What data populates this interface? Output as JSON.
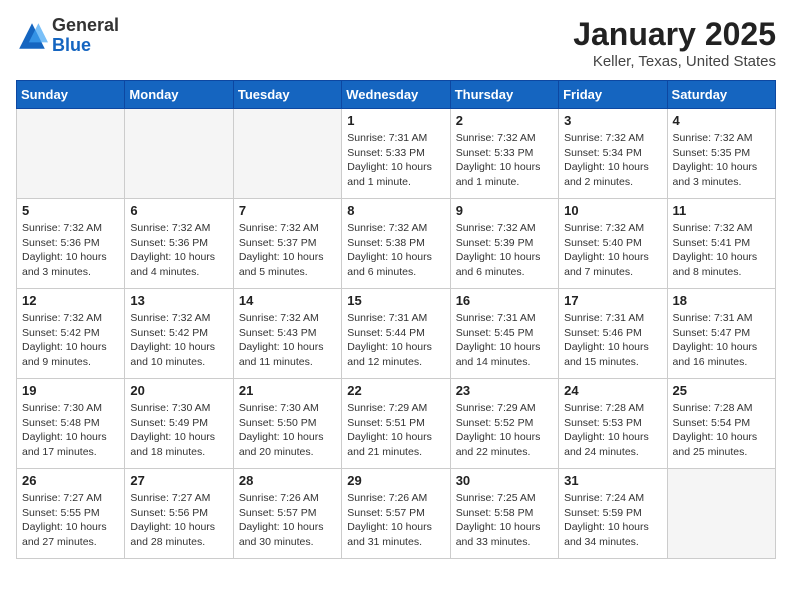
{
  "header": {
    "logo": {
      "general": "General",
      "blue": "Blue"
    },
    "title": "January 2025",
    "subtitle": "Keller, Texas, United States"
  },
  "weekdays": [
    "Sunday",
    "Monday",
    "Tuesday",
    "Wednesday",
    "Thursday",
    "Friday",
    "Saturday"
  ],
  "weeks": [
    [
      {
        "day": "",
        "empty": true
      },
      {
        "day": "",
        "empty": true
      },
      {
        "day": "",
        "empty": true
      },
      {
        "day": "1",
        "sunrise": "Sunrise: 7:31 AM",
        "sunset": "Sunset: 5:33 PM",
        "daylight": "Daylight: 10 hours and 1 minute."
      },
      {
        "day": "2",
        "sunrise": "Sunrise: 7:32 AM",
        "sunset": "Sunset: 5:33 PM",
        "daylight": "Daylight: 10 hours and 1 minute."
      },
      {
        "day": "3",
        "sunrise": "Sunrise: 7:32 AM",
        "sunset": "Sunset: 5:34 PM",
        "daylight": "Daylight: 10 hours and 2 minutes."
      },
      {
        "day": "4",
        "sunrise": "Sunrise: 7:32 AM",
        "sunset": "Sunset: 5:35 PM",
        "daylight": "Daylight: 10 hours and 3 minutes."
      }
    ],
    [
      {
        "day": "5",
        "sunrise": "Sunrise: 7:32 AM",
        "sunset": "Sunset: 5:36 PM",
        "daylight": "Daylight: 10 hours and 3 minutes."
      },
      {
        "day": "6",
        "sunrise": "Sunrise: 7:32 AM",
        "sunset": "Sunset: 5:36 PM",
        "daylight": "Daylight: 10 hours and 4 minutes."
      },
      {
        "day": "7",
        "sunrise": "Sunrise: 7:32 AM",
        "sunset": "Sunset: 5:37 PM",
        "daylight": "Daylight: 10 hours and 5 minutes."
      },
      {
        "day": "8",
        "sunrise": "Sunrise: 7:32 AM",
        "sunset": "Sunset: 5:38 PM",
        "daylight": "Daylight: 10 hours and 6 minutes."
      },
      {
        "day": "9",
        "sunrise": "Sunrise: 7:32 AM",
        "sunset": "Sunset: 5:39 PM",
        "daylight": "Daylight: 10 hours and 6 minutes."
      },
      {
        "day": "10",
        "sunrise": "Sunrise: 7:32 AM",
        "sunset": "Sunset: 5:40 PM",
        "daylight": "Daylight: 10 hours and 7 minutes."
      },
      {
        "day": "11",
        "sunrise": "Sunrise: 7:32 AM",
        "sunset": "Sunset: 5:41 PM",
        "daylight": "Daylight: 10 hours and 8 minutes."
      }
    ],
    [
      {
        "day": "12",
        "sunrise": "Sunrise: 7:32 AM",
        "sunset": "Sunset: 5:42 PM",
        "daylight": "Daylight: 10 hours and 9 minutes."
      },
      {
        "day": "13",
        "sunrise": "Sunrise: 7:32 AM",
        "sunset": "Sunset: 5:42 PM",
        "daylight": "Daylight: 10 hours and 10 minutes."
      },
      {
        "day": "14",
        "sunrise": "Sunrise: 7:32 AM",
        "sunset": "Sunset: 5:43 PM",
        "daylight": "Daylight: 10 hours and 11 minutes."
      },
      {
        "day": "15",
        "sunrise": "Sunrise: 7:31 AM",
        "sunset": "Sunset: 5:44 PM",
        "daylight": "Daylight: 10 hours and 12 minutes."
      },
      {
        "day": "16",
        "sunrise": "Sunrise: 7:31 AM",
        "sunset": "Sunset: 5:45 PM",
        "daylight": "Daylight: 10 hours and 14 minutes."
      },
      {
        "day": "17",
        "sunrise": "Sunrise: 7:31 AM",
        "sunset": "Sunset: 5:46 PM",
        "daylight": "Daylight: 10 hours and 15 minutes."
      },
      {
        "day": "18",
        "sunrise": "Sunrise: 7:31 AM",
        "sunset": "Sunset: 5:47 PM",
        "daylight": "Daylight: 10 hours and 16 minutes."
      }
    ],
    [
      {
        "day": "19",
        "sunrise": "Sunrise: 7:30 AM",
        "sunset": "Sunset: 5:48 PM",
        "daylight": "Daylight: 10 hours and 17 minutes."
      },
      {
        "day": "20",
        "sunrise": "Sunrise: 7:30 AM",
        "sunset": "Sunset: 5:49 PM",
        "daylight": "Daylight: 10 hours and 18 minutes."
      },
      {
        "day": "21",
        "sunrise": "Sunrise: 7:30 AM",
        "sunset": "Sunset: 5:50 PM",
        "daylight": "Daylight: 10 hours and 20 minutes."
      },
      {
        "day": "22",
        "sunrise": "Sunrise: 7:29 AM",
        "sunset": "Sunset: 5:51 PM",
        "daylight": "Daylight: 10 hours and 21 minutes."
      },
      {
        "day": "23",
        "sunrise": "Sunrise: 7:29 AM",
        "sunset": "Sunset: 5:52 PM",
        "daylight": "Daylight: 10 hours and 22 minutes."
      },
      {
        "day": "24",
        "sunrise": "Sunrise: 7:28 AM",
        "sunset": "Sunset: 5:53 PM",
        "daylight": "Daylight: 10 hours and 24 minutes."
      },
      {
        "day": "25",
        "sunrise": "Sunrise: 7:28 AM",
        "sunset": "Sunset: 5:54 PM",
        "daylight": "Daylight: 10 hours and 25 minutes."
      }
    ],
    [
      {
        "day": "26",
        "sunrise": "Sunrise: 7:27 AM",
        "sunset": "Sunset: 5:55 PM",
        "daylight": "Daylight: 10 hours and 27 minutes."
      },
      {
        "day": "27",
        "sunrise": "Sunrise: 7:27 AM",
        "sunset": "Sunset: 5:56 PM",
        "daylight": "Daylight: 10 hours and 28 minutes."
      },
      {
        "day": "28",
        "sunrise": "Sunrise: 7:26 AM",
        "sunset": "Sunset: 5:57 PM",
        "daylight": "Daylight: 10 hours and 30 minutes."
      },
      {
        "day": "29",
        "sunrise": "Sunrise: 7:26 AM",
        "sunset": "Sunset: 5:57 PM",
        "daylight": "Daylight: 10 hours and 31 minutes."
      },
      {
        "day": "30",
        "sunrise": "Sunrise: 7:25 AM",
        "sunset": "Sunset: 5:58 PM",
        "daylight": "Daylight: 10 hours and 33 minutes."
      },
      {
        "day": "31",
        "sunrise": "Sunrise: 7:24 AM",
        "sunset": "Sunset: 5:59 PM",
        "daylight": "Daylight: 10 hours and 34 minutes."
      },
      {
        "day": "",
        "empty": true
      }
    ]
  ]
}
